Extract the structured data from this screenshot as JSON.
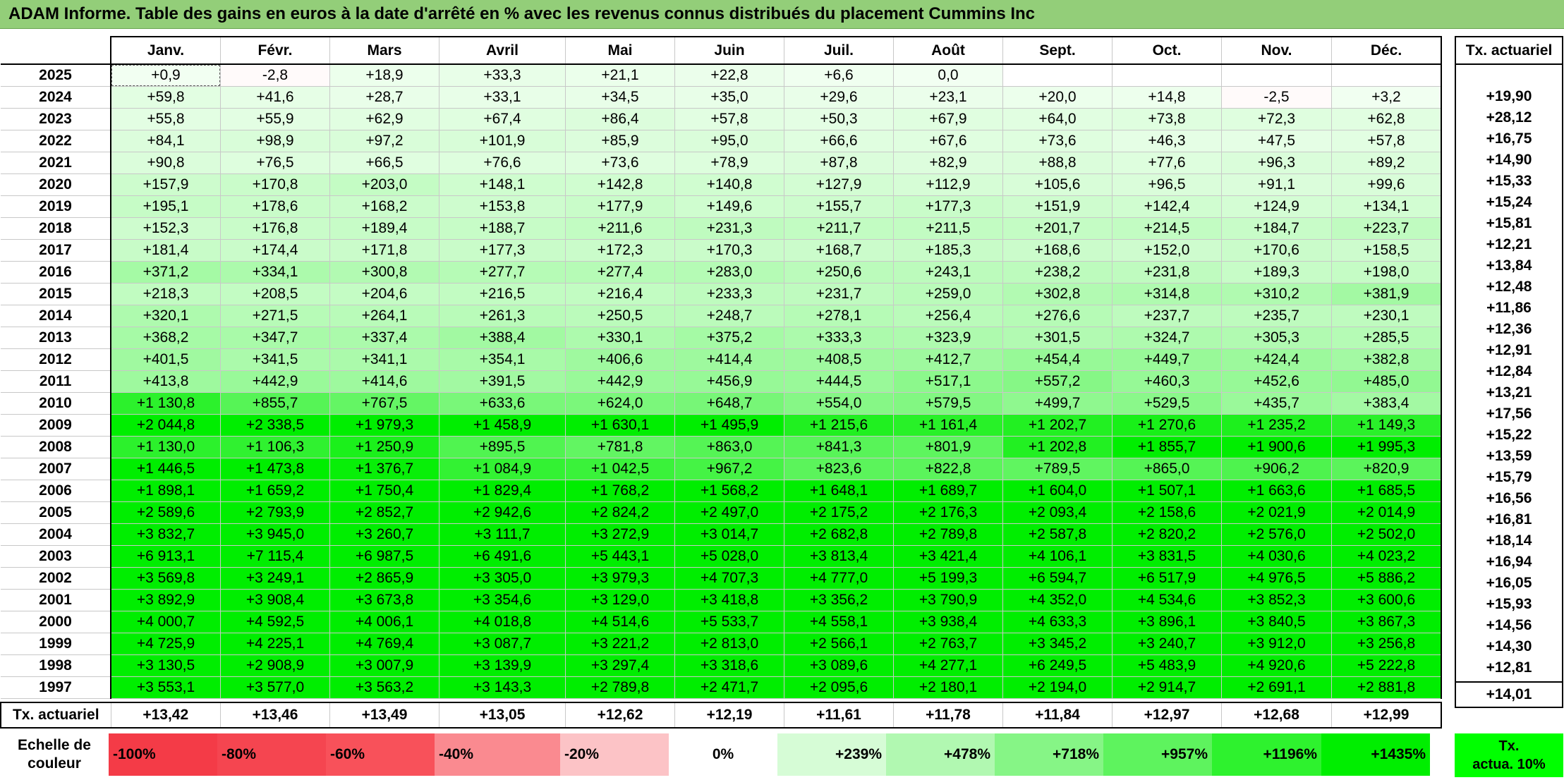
{
  "title": "ADAM Informe. Table des gains en euros à la date d'arrêté en % avec les revenus connus distribués du placement Cummins Inc",
  "chart_data": {
    "type": "heatmap",
    "columns": [
      "Janv.",
      "Févr.",
      "Mars",
      "Avril",
      "Mai",
      "Juin",
      "Juil.",
      "Août",
      "Sept.",
      "Oct.",
      "Nov.",
      "Déc."
    ],
    "actuarial_header": "Tx. actuariel",
    "rows": [
      {
        "year": "2025",
        "values": [
          "+0,9",
          "-2,8",
          "+18,9",
          "+33,3",
          "+21,1",
          "+22,8",
          "+6,6",
          "0,0",
          "",
          "",
          "",
          ""
        ],
        "actuarial": ""
      },
      {
        "year": "2024",
        "values": [
          "+59,8",
          "+41,6",
          "+28,7",
          "+33,1",
          "+34,5",
          "+35,0",
          "+29,6",
          "+23,1",
          "+20,0",
          "+14,8",
          "-2,5",
          "+3,2"
        ],
        "actuarial": "+19,90"
      },
      {
        "year": "2023",
        "values": [
          "+55,8",
          "+55,9",
          "+62,9",
          "+67,4",
          "+86,4",
          "+57,8",
          "+50,3",
          "+67,9",
          "+64,0",
          "+73,8",
          "+72,3",
          "+62,8"
        ],
        "actuarial": "+28,12"
      },
      {
        "year": "2022",
        "values": [
          "+84,1",
          "+98,9",
          "+97,2",
          "+101,9",
          "+85,9",
          "+95,0",
          "+66,6",
          "+67,6",
          "+73,6",
          "+46,3",
          "+47,5",
          "+57,8"
        ],
        "actuarial": "+16,75"
      },
      {
        "year": "2021",
        "values": [
          "+90,8",
          "+76,5",
          "+66,5",
          "+76,6",
          "+73,6",
          "+78,9",
          "+87,8",
          "+82,9",
          "+88,8",
          "+77,6",
          "+96,3",
          "+89,2"
        ],
        "actuarial": "+14,90"
      },
      {
        "year": "2020",
        "values": [
          "+157,9",
          "+170,8",
          "+203,0",
          "+148,1",
          "+142,8",
          "+140,8",
          "+127,9",
          "+112,9",
          "+105,6",
          "+96,5",
          "+91,1",
          "+99,6"
        ],
        "actuarial": "+15,33"
      },
      {
        "year": "2019",
        "values": [
          "+195,1",
          "+178,6",
          "+168,2",
          "+153,8",
          "+177,9",
          "+149,6",
          "+155,7",
          "+177,3",
          "+151,9",
          "+142,4",
          "+124,9",
          "+134,1"
        ],
        "actuarial": "+15,24"
      },
      {
        "year": "2018",
        "values": [
          "+152,3",
          "+176,8",
          "+189,4",
          "+188,7",
          "+211,6",
          "+231,3",
          "+211,7",
          "+211,5",
          "+201,7",
          "+214,5",
          "+184,7",
          "+223,7"
        ],
        "actuarial": "+15,81"
      },
      {
        "year": "2017",
        "values": [
          "+181,4",
          "+174,4",
          "+171,8",
          "+177,3",
          "+172,3",
          "+170,3",
          "+168,7",
          "+185,3",
          "+168,6",
          "+152,0",
          "+170,6",
          "+158,5"
        ],
        "actuarial": "+12,21"
      },
      {
        "year": "2016",
        "values": [
          "+371,2",
          "+334,1",
          "+300,8",
          "+277,7",
          "+277,4",
          "+283,0",
          "+250,6",
          "+243,1",
          "+238,2",
          "+231,8",
          "+189,3",
          "+198,0"
        ],
        "actuarial": "+13,84"
      },
      {
        "year": "2015",
        "values": [
          "+218,3",
          "+208,5",
          "+204,6",
          "+216,5",
          "+216,4",
          "+233,3",
          "+231,7",
          "+259,0",
          "+302,8",
          "+314,8",
          "+310,2",
          "+381,9"
        ],
        "actuarial": "+12,48"
      },
      {
        "year": "2014",
        "values": [
          "+320,1",
          "+271,5",
          "+264,1",
          "+261,3",
          "+250,5",
          "+248,7",
          "+278,1",
          "+256,4",
          "+276,6",
          "+237,7",
          "+235,7",
          "+230,1"
        ],
        "actuarial": "+11,86"
      },
      {
        "year": "2013",
        "values": [
          "+368,2",
          "+347,7",
          "+337,4",
          "+388,4",
          "+330,1",
          "+375,2",
          "+333,3",
          "+323,9",
          "+301,5",
          "+324,7",
          "+305,3",
          "+285,5"
        ],
        "actuarial": "+12,36"
      },
      {
        "year": "2012",
        "values": [
          "+401,5",
          "+341,5",
          "+341,1",
          "+354,1",
          "+406,6",
          "+414,4",
          "+408,5",
          "+412,7",
          "+454,4",
          "+449,7",
          "+424,4",
          "+382,8"
        ],
        "actuarial": "+12,91"
      },
      {
        "year": "2011",
        "values": [
          "+413,8",
          "+442,9",
          "+414,6",
          "+391,5",
          "+442,9",
          "+456,9",
          "+444,5",
          "+517,1",
          "+557,2",
          "+460,3",
          "+452,6",
          "+485,0"
        ],
        "actuarial": "+12,84"
      },
      {
        "year": "2010",
        "values": [
          "+1 130,8",
          "+855,7",
          "+767,5",
          "+633,6",
          "+624,0",
          "+648,7",
          "+554,0",
          "+579,5",
          "+499,7",
          "+529,5",
          "+435,7",
          "+383,4"
        ],
        "actuarial": "+13,21"
      },
      {
        "year": "2009",
        "values": [
          "+2 044,8",
          "+2 338,5",
          "+1 979,3",
          "+1 458,9",
          "+1 630,1",
          "+1 495,9",
          "+1 215,6",
          "+1 161,4",
          "+1 202,7",
          "+1 270,6",
          "+1 235,2",
          "+1 149,3"
        ],
        "actuarial": "+17,56"
      },
      {
        "year": "2008",
        "values": [
          "+1 130,0",
          "+1 106,3",
          "+1 250,9",
          "+895,5",
          "+781,8",
          "+863,0",
          "+841,3",
          "+801,9",
          "+1 202,8",
          "+1 855,7",
          "+1 900,6",
          "+1 995,3"
        ],
        "actuarial": "+15,22"
      },
      {
        "year": "2007",
        "values": [
          "+1 446,5",
          "+1 473,8",
          "+1 376,7",
          "+1 084,9",
          "+1 042,5",
          "+967,2",
          "+823,6",
          "+822,8",
          "+789,5",
          "+865,0",
          "+906,2",
          "+820,9"
        ],
        "actuarial": "+13,59"
      },
      {
        "year": "2006",
        "values": [
          "+1 898,1",
          "+1 659,2",
          "+1 750,4",
          "+1 829,4",
          "+1 768,2",
          "+1 568,2",
          "+1 648,1",
          "+1 689,7",
          "+1 604,0",
          "+1 507,1",
          "+1 663,6",
          "+1 685,5"
        ],
        "actuarial": "+15,79"
      },
      {
        "year": "2005",
        "values": [
          "+2 589,6",
          "+2 793,9",
          "+2 852,7",
          "+2 942,6",
          "+2 824,2",
          "+2 497,0",
          "+2 175,2",
          "+2 176,3",
          "+2 093,4",
          "+2 158,6",
          "+2 021,9",
          "+2 014,9"
        ],
        "actuarial": "+16,56"
      },
      {
        "year": "2004",
        "values": [
          "+3 832,7",
          "+3 945,0",
          "+3 260,7",
          "+3 111,7",
          "+3 272,9",
          "+3 014,7",
          "+2 682,8",
          "+2 789,8",
          "+2 587,8",
          "+2 820,2",
          "+2 576,0",
          "+2 502,0"
        ],
        "actuarial": "+16,81"
      },
      {
        "year": "2003",
        "values": [
          "+6 913,1",
          "+7 115,4",
          "+6 987,5",
          "+6 491,6",
          "+5 443,1",
          "+5 028,0",
          "+3 813,4",
          "+3 421,4",
          "+4 106,1",
          "+3 831,5",
          "+4 030,6",
          "+4 023,2"
        ],
        "actuarial": "+18,14"
      },
      {
        "year": "2002",
        "values": [
          "+3 569,8",
          "+3 249,1",
          "+2 865,9",
          "+3 305,0",
          "+3 979,3",
          "+4 707,3",
          "+4 777,0",
          "+5 199,3",
          "+6 594,7",
          "+6 517,9",
          "+4 976,5",
          "+5 886,2"
        ],
        "actuarial": "+16,94"
      },
      {
        "year": "2001",
        "values": [
          "+3 892,9",
          "+3 908,4",
          "+3 673,8",
          "+3 354,6",
          "+3 129,0",
          "+3 418,8",
          "+3 356,2",
          "+3 790,9",
          "+4 352,0",
          "+4 534,6",
          "+3 852,3",
          "+3 600,6"
        ],
        "actuarial": "+16,05"
      },
      {
        "year": "2000",
        "values": [
          "+4 000,7",
          "+4 592,5",
          "+4 006,1",
          "+4 018,8",
          "+4 514,6",
          "+5 533,7",
          "+4 558,1",
          "+3 938,4",
          "+4 633,3",
          "+3 896,1",
          "+3 840,5",
          "+3 867,3"
        ],
        "actuarial": "+15,93"
      },
      {
        "year": "1999",
        "values": [
          "+4 725,9",
          "+4 225,1",
          "+4 769,4",
          "+3 087,7",
          "+3 221,2",
          "+2 813,0",
          "+2 566,1",
          "+2 763,7",
          "+3 345,2",
          "+3 240,7",
          "+3 912,0",
          "+3 256,8"
        ],
        "actuarial": "+14,56"
      },
      {
        "year": "1998",
        "values": [
          "+3 130,5",
          "+2 908,9",
          "+3 007,9",
          "+3 139,9",
          "+3 297,4",
          "+3 318,6",
          "+3 089,6",
          "+4 277,1",
          "+6 249,5",
          "+5 483,9",
          "+4 920,6",
          "+5 222,8"
        ],
        "actuarial": "+14,30"
      },
      {
        "year": "1997",
        "values": [
          "+3 553,1",
          "+3 577,0",
          "+3 563,2",
          "+3 143,3",
          "+2 789,8",
          "+2 471,7",
          "+2 095,6",
          "+2 180,1",
          "+2 194,0",
          "+2 914,7",
          "+2 691,1",
          "+2 881,8"
        ],
        "actuarial": "+12,81"
      }
    ],
    "actuarial_row": {
      "label": "Tx. actuariel",
      "values": [
        "+13,42",
        "+13,46",
        "+13,49",
        "+13,05",
        "+12,62",
        "+12,19",
        "+11,61",
        "+11,78",
        "+11,84",
        "+12,97",
        "+12,68",
        "+12,99"
      ],
      "overall": "+14,01"
    },
    "scale": {
      "label_line1": "Echelle de",
      "label_line2": "couleur",
      "stops": [
        {
          "text": "-100%",
          "color": "#f43b47"
        },
        {
          "text": "-80%",
          "color": "#f54550"
        },
        {
          "text": "-60%",
          "color": "#f8515a"
        },
        {
          "text": "-40%",
          "color": "#fa8a90"
        },
        {
          "text": "-20%",
          "color": "#fcc3c6"
        },
        {
          "text": "0%",
          "color": "#ffffff"
        },
        {
          "text": "+239%",
          "color": "#d6fcd6"
        },
        {
          "text": "+478%",
          "color": "#b1f8b1"
        },
        {
          "text": "+718%",
          "color": "#86f586"
        },
        {
          "text": "+957%",
          "color": "#5ef35e"
        },
        {
          "text": "+1196%",
          "color": "#2ef22e"
        },
        {
          "text": "+1435%",
          "color": "#00ee00"
        }
      ],
      "actuarial_legend_line1": "Tx.",
      "actuarial_legend_line2": "actua. 10%"
    }
  }
}
